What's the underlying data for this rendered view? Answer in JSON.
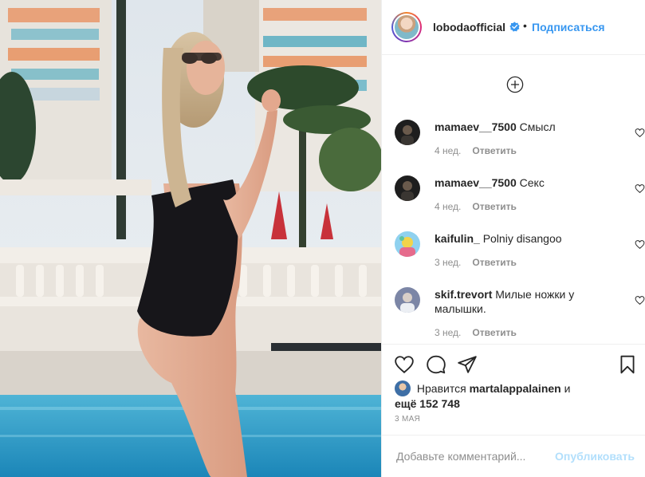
{
  "header": {
    "username": "lobodaofficial",
    "separator": "•",
    "follow_label": "Подписаться"
  },
  "comments": [
    {
      "user": "mamaev__7500",
      "text": "Смысл",
      "age": "4 нед.",
      "reply_label": "Ответить"
    },
    {
      "user": "mamaev__7500",
      "text": "Секс",
      "age": "4 нед.",
      "reply_label": "Ответить"
    },
    {
      "user": "kaifulin_",
      "text": "Polniy disangoo",
      "age": "3 нед.",
      "reply_label": "Ответить"
    },
    {
      "user": "skif.trevort",
      "text": "Милые ножки у малышки.",
      "age": "3 нед.",
      "reply_label": "Ответить"
    }
  ],
  "likes": {
    "prefix": "Нравится",
    "user": "martalappalainen",
    "conjunction": "и",
    "others": "ещё 152 748"
  },
  "date": "3 МАЯ",
  "add_comment": {
    "placeholder": "Добавьте комментарий...",
    "publish_label": "Опубликовать"
  },
  "colors": {
    "link_blue": "#3897f0",
    "publish_disabled": "#b2dffc",
    "muted": "#8e8e8e",
    "text": "#262626",
    "border": "#efefef"
  }
}
